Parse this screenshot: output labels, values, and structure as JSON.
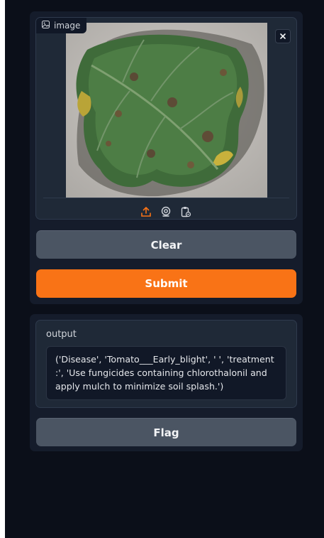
{
  "input": {
    "label": "image",
    "icons": {
      "label_icon": "image-icon",
      "close": "close-icon",
      "upload": "upload-icon",
      "webcam": "webcam-icon",
      "clipboard": "clipboard-icon"
    }
  },
  "buttons": {
    "clear": "Clear",
    "submit": "Submit",
    "flag": "Flag"
  },
  "output": {
    "label": "output",
    "value": "('Disease', 'Tomato___Early_blight', ' ', 'treatment :', 'Use fungicides containing chlorothalonil and apply mulch to minimize soil splash.')"
  },
  "colors": {
    "background": "#0b0f19",
    "panel": "#151c2b",
    "block": "#1f2937",
    "primary": "#f97316",
    "secondary": "#4b5563"
  }
}
